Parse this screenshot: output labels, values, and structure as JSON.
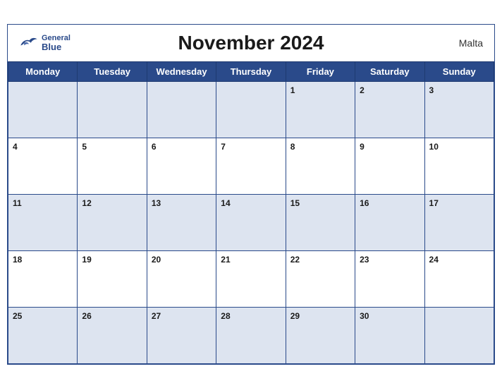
{
  "header": {
    "month_year": "November 2024",
    "country": "Malta",
    "logo_general": "General",
    "logo_blue": "Blue"
  },
  "weekdays": [
    "Monday",
    "Tuesday",
    "Wednesday",
    "Thursday",
    "Friday",
    "Saturday",
    "Sunday"
  ],
  "weeks": [
    [
      "",
      "",
      "",
      "",
      "1",
      "2",
      "3"
    ],
    [
      "4",
      "5",
      "6",
      "7",
      "8",
      "9",
      "10"
    ],
    [
      "11",
      "12",
      "13",
      "14",
      "15",
      "16",
      "17"
    ],
    [
      "18",
      "19",
      "20",
      "21",
      "22",
      "23",
      "24"
    ],
    [
      "25",
      "26",
      "27",
      "28",
      "29",
      "30",
      ""
    ]
  ]
}
